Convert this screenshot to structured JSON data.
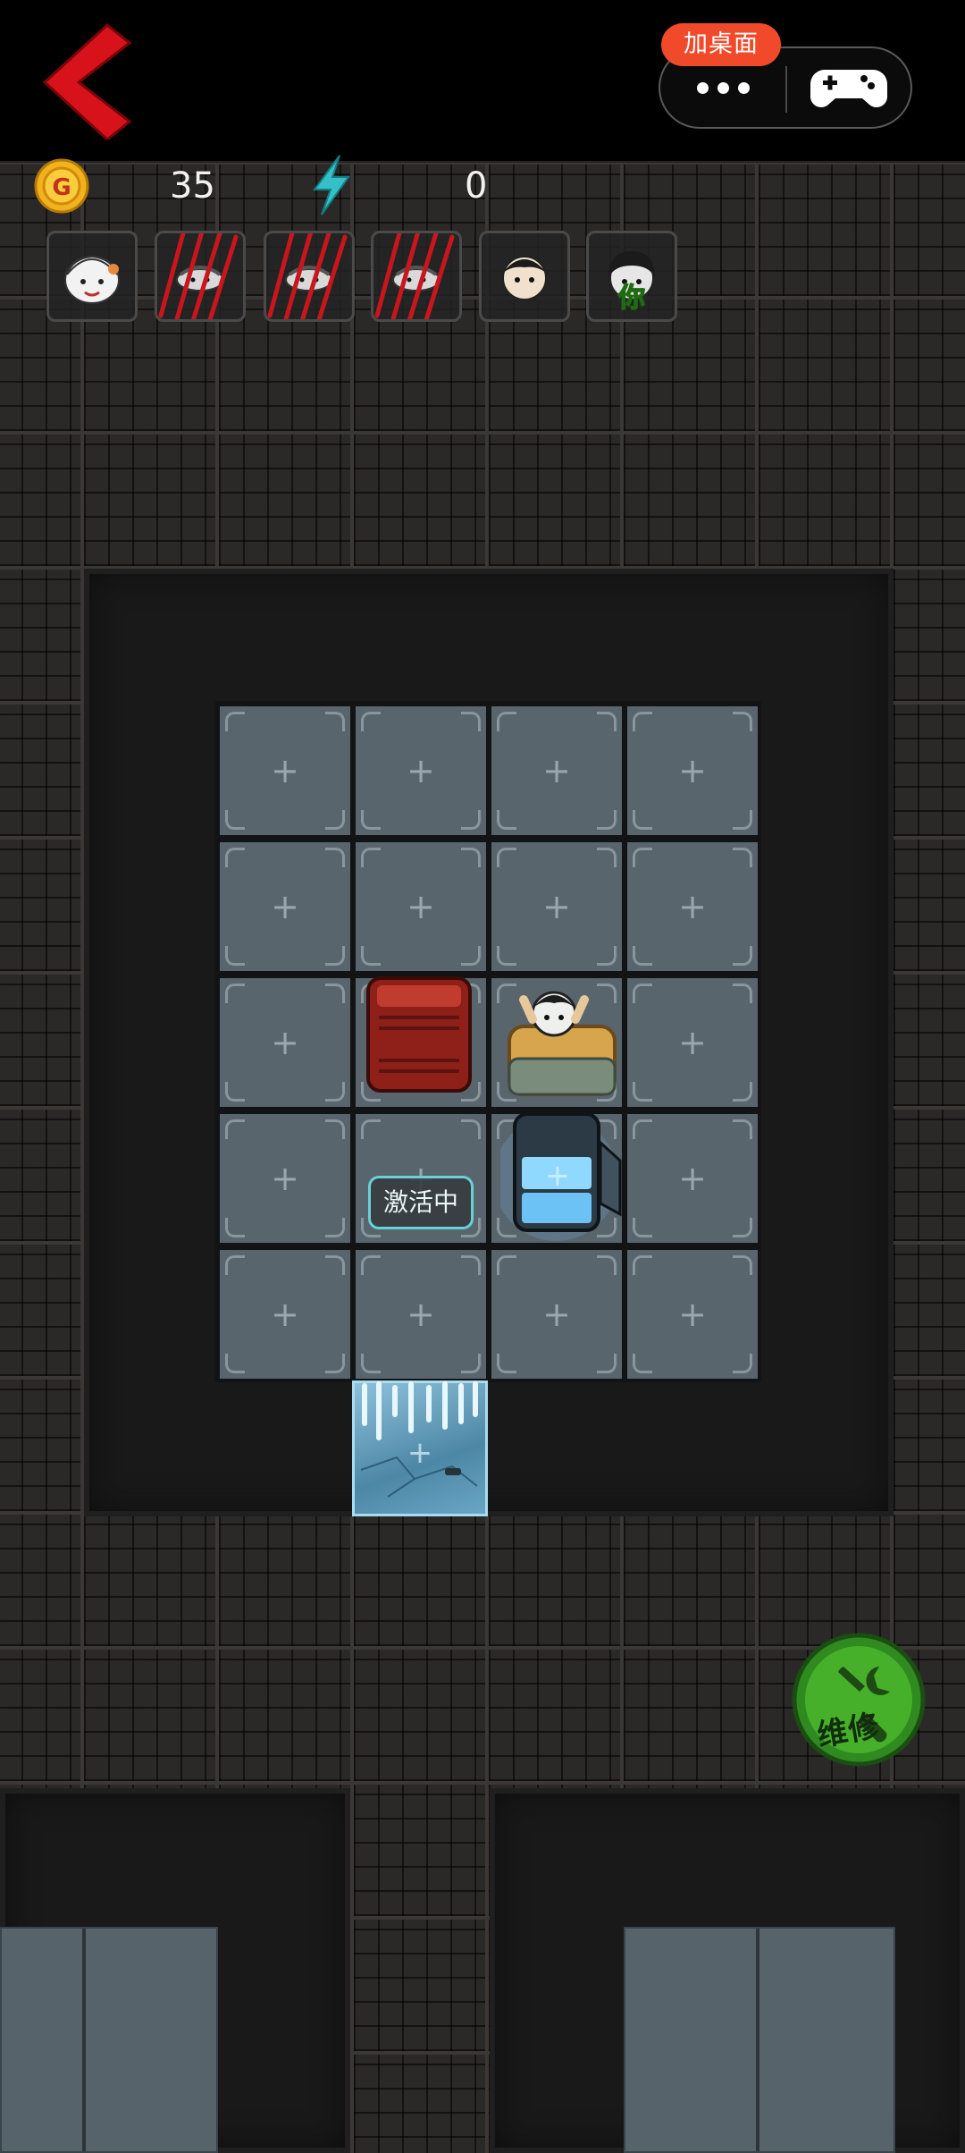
{
  "header": {
    "add_desktop_label": "加桌面"
  },
  "stats": {
    "coin_icon_letter": "G",
    "coins": "35",
    "energy": "0"
  },
  "characters": [
    {
      "name": "grandma-avatar-icon",
      "state": "alive"
    },
    {
      "name": "dad-avatar-icon",
      "state": "slashed"
    },
    {
      "name": "mom-avatar-icon",
      "state": "slashed"
    },
    {
      "name": "ghost-avatar-icon",
      "state": "slashed"
    },
    {
      "name": "girl-avatar-icon",
      "state": "alive"
    },
    {
      "name": "player-avatar-icon",
      "state": "selected",
      "badge": "你"
    }
  ],
  "room": {
    "cell_symbol": "+",
    "active_label": "激活中"
  },
  "repair": {
    "label": "维修"
  },
  "colors": {
    "accent_red": "#d8121a",
    "add_desktop_bg": "#f04a2a",
    "coin_gold": "#f2b21c",
    "energy_cyan": "#35c0c8",
    "repair_green": "#46b02a",
    "cell_fill": "#58656d"
  }
}
